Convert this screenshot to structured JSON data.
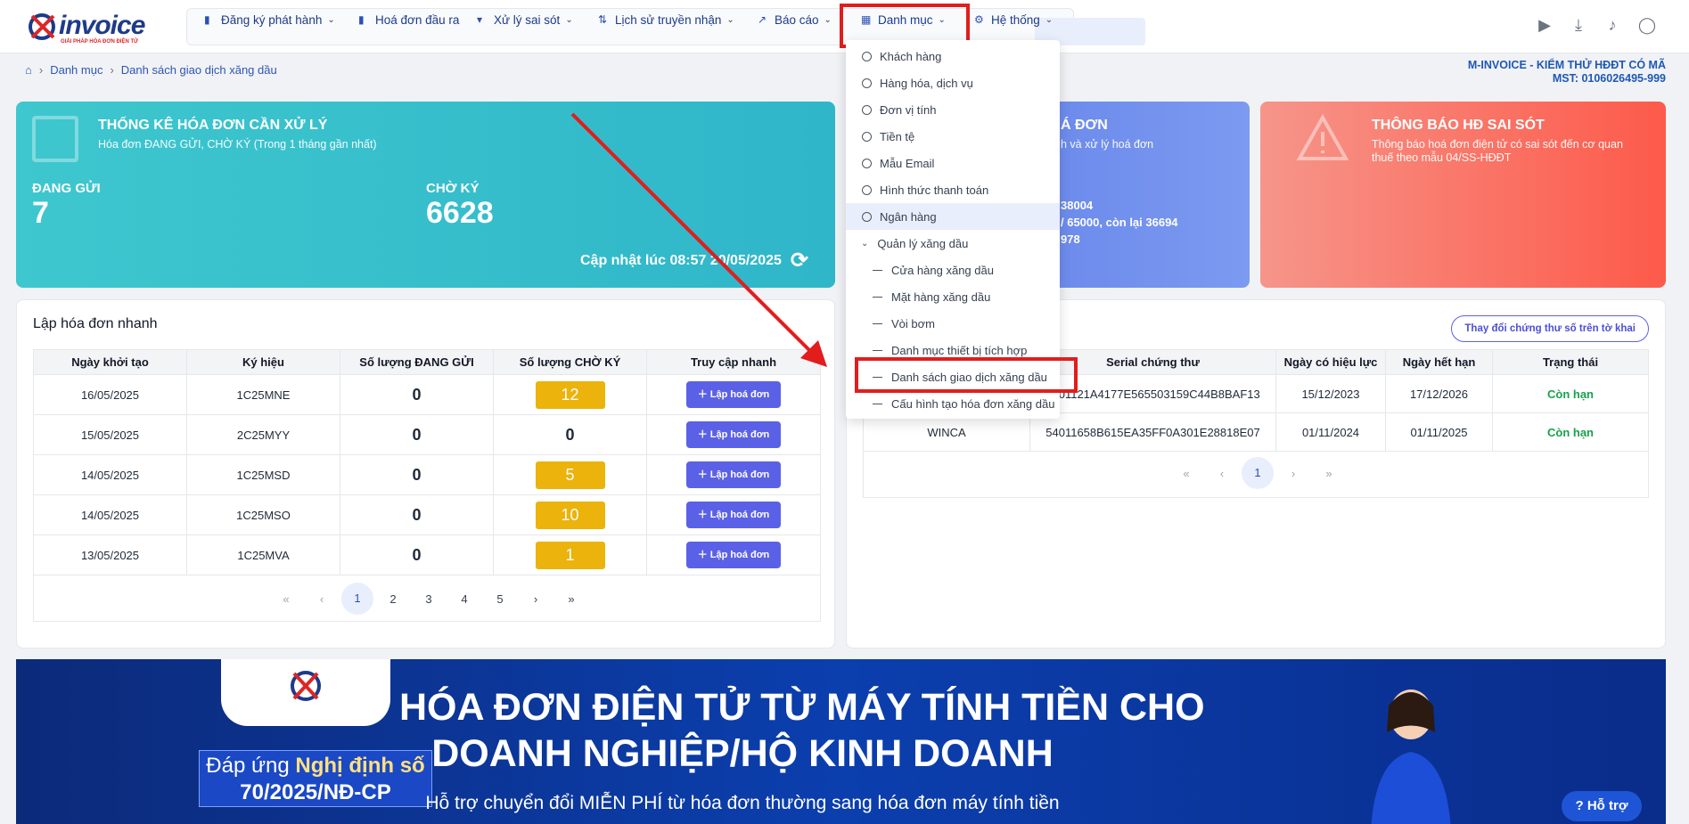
{
  "brand": {
    "name": "invoice",
    "tagline": "GIẢI PHÁP HÓA ĐƠN ĐIỆN TỬ"
  },
  "nav": [
    {
      "label": "Đăng ký phát hành",
      "icon": "file-icon"
    },
    {
      "label": "Hoá đơn đầu ra",
      "icon": "document-icon"
    },
    {
      "label": "Xử lý sai sót",
      "icon": "filter-icon"
    },
    {
      "label": "Lịch sử truyền nhận",
      "icon": "transfer-icon"
    },
    {
      "label": "Báo cáo",
      "icon": "chart-icon"
    },
    {
      "label": "Danh mục",
      "icon": "grid-icon"
    },
    {
      "label": "Hệ thống",
      "icon": "gear-icon"
    }
  ],
  "breadcrumb": {
    "level1": "Danh mục",
    "level2": "Danh sách giao dịch xăng dầu"
  },
  "company": {
    "name": "M-INVOICE - KIỂM THỬ HĐĐT CÓ MÃ",
    "mst": "MST: 0106026495-999"
  },
  "stats": {
    "title": "THỐNG KÊ HÓA ĐƠN CẦN XỬ LÝ",
    "subtitle": "Hóa đơn ĐANG GỬI, CHỜ KÝ (Trong 1 tháng gần nhất)",
    "sending_label": "ĐANG GỬI",
    "sending_value": "7",
    "waiting_label": "CHỜ KÝ",
    "waiting_value": "6628",
    "updated": "Cập nhật lúc 08:57 20/05/2025"
  },
  "card2": {
    "title_partial": "Á ĐƠN",
    "sub_partial": "h và xử lý hoá đơn",
    "line1": "38004",
    "line2": "/ 65000, còn lại 36694",
    "line3": "978"
  },
  "card3": {
    "title": "THÔNG BÁO HĐ SAI SÓT",
    "subtitle_line1": "Thông báo hoá đơn điện tử có sai sót đến cơ quan",
    "subtitle_line2": "thuế theo mẫu 04/SS-HĐĐT"
  },
  "quick": {
    "title": "Lập hóa đơn nhanh",
    "headers": [
      "Ngày khởi tạo",
      "Ký hiệu",
      "Số lượng ĐANG GỬI",
      "Số lượng CHỜ KÝ",
      "Truy cập nhanh"
    ],
    "button_label": "Lập hoá đơn",
    "rows": [
      {
        "date": "16/05/2025",
        "symbol": "1C25MNE",
        "sending": "0",
        "waiting": "12"
      },
      {
        "date": "15/05/2025",
        "symbol": "2C25MYY",
        "sending": "0",
        "waiting": "0"
      },
      {
        "date": "14/05/2025",
        "symbol": "1C25MSD",
        "sending": "0",
        "waiting": "5"
      },
      {
        "date": "14/05/2025",
        "symbol": "1C25MSO",
        "sending": "0",
        "waiting": "10"
      },
      {
        "date": "13/05/2025",
        "symbol": "1C25MVA",
        "sending": "0",
        "waiting": "1"
      }
    ],
    "pages": [
      "«",
      "‹",
      "1",
      "2",
      "3",
      "4",
      "5",
      "›",
      "»"
    ]
  },
  "certs": {
    "change_button": "Thay đổi chứng thư số trên tờ khai",
    "headers": [
      "Serial chứng thư",
      "Ngày có hiệu lực",
      "Ngày hết hạn",
      "Trạng thái"
    ],
    "rows": [
      {
        "provider": "",
        "serial": "5401121A4177E565503159C44B8BAF13",
        "from": "15/12/2023",
        "to": "17/12/2026",
        "status": "Còn hạn"
      },
      {
        "provider": "WINCA",
        "serial": "54011658B615EA35FF0A301E28818E07",
        "from": "01/11/2024",
        "to": "01/11/2025",
        "status": "Còn hạn"
      }
    ],
    "pages": [
      "«",
      "‹",
      "1",
      "›",
      "»"
    ]
  },
  "dropdown": [
    {
      "label": "Khách hàng",
      "type": "circle"
    },
    {
      "label": "Hàng hóa, dịch vụ",
      "type": "circle"
    },
    {
      "label": "Đơn vị tính",
      "type": "circle"
    },
    {
      "label": "Tiền tệ",
      "type": "circle"
    },
    {
      "label": "Mẫu Email",
      "type": "circle"
    },
    {
      "label": "Hình thức thanh toán",
      "type": "circle"
    },
    {
      "label": "Ngân hàng",
      "type": "circle"
    },
    {
      "label": "Quản lý xăng dầu",
      "type": "group"
    },
    {
      "label": "Cửa hàng xăng dầu",
      "type": "dash"
    },
    {
      "label": "Mặt hàng xăng dầu",
      "type": "dash"
    },
    {
      "label": "Vòi bơm",
      "type": "dash"
    },
    {
      "label": "Danh mục thiết bị tích hợp",
      "type": "dash"
    },
    {
      "label": "Danh sách giao dịch xăng dầu",
      "type": "dash"
    },
    {
      "label": "Cấu hình tạo hóa đơn xăng dầu",
      "type": "dash"
    }
  ],
  "banner": {
    "headline1": "HÓA ĐƠN ĐIỆN TỬ TỪ MÁY TÍNH TIỀN CHO",
    "headline2": "DOANH NGHIỆP/HỘ KINH DOANH",
    "sub": "Hỗ trợ chuyển đổi MIỄN PHÍ từ hóa đơn thường sang hóa đơn máy tính tiền",
    "box_line1_a": "Đáp ứng ",
    "box_line1_b": "Nghị định số",
    "box_line2": "70/2025/NĐ-CP"
  },
  "help": "Hỗ trợ"
}
